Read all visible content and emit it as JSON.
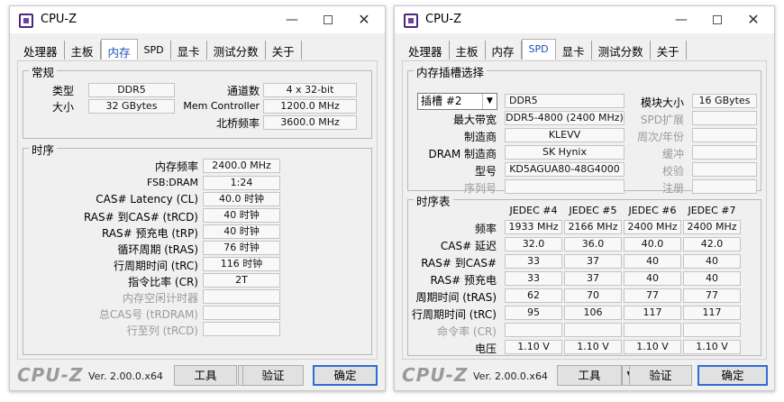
{
  "app_title": "CPU-Z",
  "titlebar": {
    "min": "—",
    "close": "✕"
  },
  "tabs": [
    "处理器",
    "主板",
    "内存",
    "SPD",
    "显卡",
    "测试分数",
    "关于"
  ],
  "icons": {
    "app": "cpu-z-icon",
    "dropdown": "▼"
  },
  "colors": {
    "active_tab_text": "#1a4fb5",
    "default_button_border": "#2f6fd0"
  },
  "left": {
    "active_tab": "内存",
    "general": {
      "title": "常规",
      "type_label": "类型",
      "type_value": "DDR5",
      "size_label": "大小",
      "size_value": "32 GBytes",
      "channels_label": "通道数",
      "channels_value": "4 x 32-bit",
      "memctrl_label": "Mem Controller",
      "memctrl_value": "1200.0 MHz",
      "nb_label": "北桥频率",
      "nb_value": "3600.0 MHz"
    },
    "timings": {
      "title": "时序",
      "rows": [
        {
          "label": "内存频率",
          "value": "2400.0 MHz",
          "disabled": false
        },
        {
          "label": "FSB:DRAM",
          "value": "1:24",
          "disabled": false
        },
        {
          "label": "CAS# Latency (CL)",
          "value": "40.0 时钟",
          "disabled": false
        },
        {
          "label": "RAS# 到CAS# (tRCD)",
          "value": "40 时钟",
          "disabled": false
        },
        {
          "label": "RAS# 预充电 (tRP)",
          "value": "40 时钟",
          "disabled": false
        },
        {
          "label": "循环周期 (tRAS)",
          "value": "76 时钟",
          "disabled": false
        },
        {
          "label": "行周期时间 (tRC)",
          "value": "116 时钟",
          "disabled": false
        },
        {
          "label": "指令比率 (CR)",
          "value": "2T",
          "disabled": false
        },
        {
          "label": "内存空闲计时器",
          "value": "",
          "disabled": true
        },
        {
          "label": "总CAS号 (tRDRAM)",
          "value": "",
          "disabled": true
        },
        {
          "label": "行至列 (tRCD)",
          "value": "",
          "disabled": true
        }
      ]
    },
    "bottom": {
      "logo": "CPU-Z",
      "version": "Ver. 2.00.0.x64",
      "tools": "工具",
      "validate": "验证",
      "ok": "确定"
    }
  },
  "right": {
    "active_tab": "SPD",
    "slot": {
      "title": "内存插槽选择",
      "selected": "插槽 #2",
      "type_value": "DDR5",
      "max_bw_label": "最大带宽",
      "max_bw_value": "DDR5-4800 (2400 MHz)",
      "mfr_label": "制造商",
      "mfr_value": "KLEVV",
      "dram_mfr_label": "DRAM 制造商",
      "dram_mfr_value": "SK Hynix",
      "part_label": "型号",
      "part_value": "KD5AGUA80-48G4000",
      "serial_label": "序列号",
      "serial_value": "",
      "module_size_label": "模块大小",
      "module_size_value": "16 GBytes",
      "spd_ext_label": "SPD扩展",
      "spd_ext_value": "",
      "week_year_label": "周次/年份",
      "week_year_value": "",
      "buffered_label": "缓冲",
      "buffered_value": "",
      "correction_label": "校验",
      "correction_value": "",
      "registered_label": "注册",
      "registered_value": ""
    },
    "timings_table": {
      "title": "时序表",
      "columns": [
        "JEDEC #4",
        "JEDEC #5",
        "JEDEC #6",
        "JEDEC #7"
      ],
      "rows": [
        {
          "label": "频率",
          "values": [
            "1933 MHz",
            "2166 MHz",
            "2400 MHz",
            "2400 MHz"
          ],
          "disabled": false
        },
        {
          "label": "CAS# 延迟",
          "values": [
            "32.0",
            "36.0",
            "40.0",
            "42.0"
          ],
          "disabled": false
        },
        {
          "label": "RAS# 到CAS#",
          "values": [
            "33",
            "37",
            "40",
            "40"
          ],
          "disabled": false
        },
        {
          "label": "RAS# 预充电",
          "values": [
            "33",
            "37",
            "40",
            "40"
          ],
          "disabled": false
        },
        {
          "label": "周期时间 (tRAS)",
          "values": [
            "62",
            "70",
            "77",
            "77"
          ],
          "disabled": false
        },
        {
          "label": "行周期时间 (tRC)",
          "values": [
            "95",
            "106",
            "117",
            "117"
          ],
          "disabled": false
        },
        {
          "label": "命令率 (CR)",
          "values": [
            "",
            "",
            "",
            ""
          ],
          "disabled": true
        },
        {
          "label": "电压",
          "values": [
            "1.10 V",
            "1.10 V",
            "1.10 V",
            "1.10 V"
          ],
          "disabled": false
        }
      ]
    },
    "bottom": {
      "logo": "CPU-Z",
      "version": "Ver. 2.00.0.x64",
      "tools": "工具",
      "validate": "验证",
      "ok": "确定"
    }
  }
}
